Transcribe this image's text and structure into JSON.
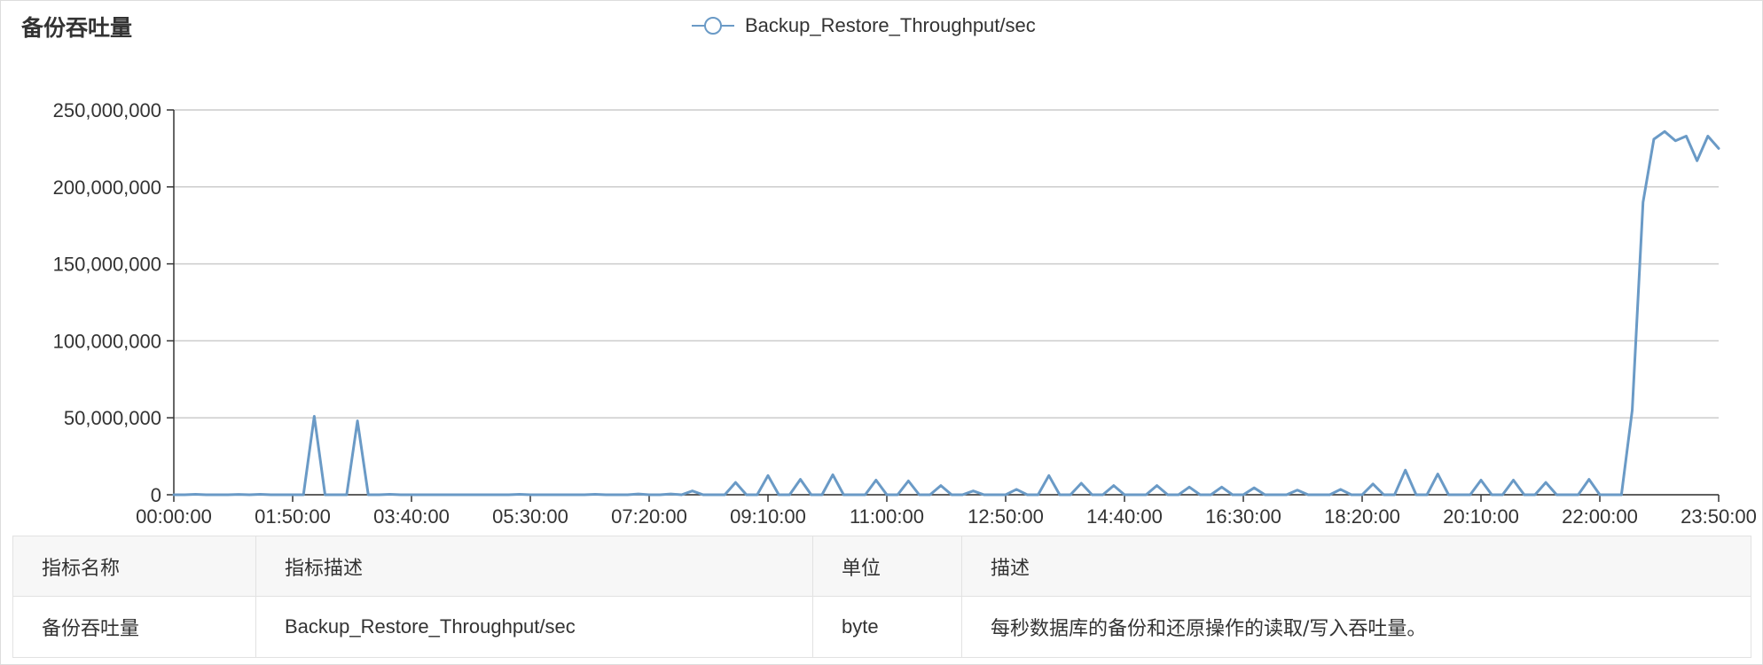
{
  "panel": {
    "title": "备份吞吐量"
  },
  "chart_data": {
    "type": "line",
    "title": "",
    "xlabel": "",
    "ylabel": "",
    "x_ticks": [
      "00:00:00",
      "01:50:00",
      "03:40:00",
      "05:30:00",
      "07:20:00",
      "09:10:00",
      "11:00:00",
      "12:50:00",
      "14:40:00",
      "16:30:00",
      "18:20:00",
      "20:10:00",
      "22:00:00",
      "23:50:00"
    ],
    "y_ticks": [
      "0",
      "50,000,000",
      "100,000,000",
      "150,000,000",
      "200,000,000",
      "250,000,000"
    ],
    "ylim": [
      0,
      250000000
    ],
    "xlim_minutes": [
      0,
      1430
    ],
    "x_minutes": [
      0,
      10,
      20,
      30,
      40,
      50,
      60,
      70,
      80,
      90,
      100,
      110,
      120,
      130,
      140,
      150,
      160,
      170,
      180,
      190,
      200,
      210,
      220,
      230,
      240,
      250,
      260,
      270,
      280,
      290,
      300,
      310,
      320,
      330,
      340,
      350,
      360,
      370,
      380,
      390,
      400,
      410,
      420,
      430,
      440,
      450,
      460,
      470,
      480,
      490,
      500,
      510,
      520,
      530,
      540,
      550,
      560,
      570,
      580,
      590,
      600,
      610,
      620,
      630,
      640,
      650,
      660,
      670,
      680,
      690,
      700,
      710,
      720,
      730,
      740,
      750,
      760,
      770,
      780,
      790,
      800,
      810,
      820,
      830,
      840,
      850,
      860,
      870,
      880,
      890,
      900,
      910,
      920,
      930,
      940,
      950,
      960,
      970,
      980,
      990,
      1000,
      1010,
      1020,
      1030,
      1040,
      1050,
      1060,
      1070,
      1080,
      1090,
      1100,
      1110,
      1120,
      1130,
      1140,
      1150,
      1160,
      1170,
      1180,
      1190,
      1200,
      1210,
      1220,
      1230,
      1240,
      1250,
      1260,
      1270,
      1280,
      1290,
      1300,
      1310,
      1320,
      1330,
      1340,
      1350,
      1360,
      1370,
      1380,
      1390,
      1400,
      1410,
      1420,
      1430
    ],
    "series": [
      {
        "name": "Backup_Restore_Throughput/sec",
        "color": "#6a9ac6",
        "values": [
          0,
          0,
          300000,
          0,
          0,
          0,
          200000,
          0,
          300000,
          0,
          0,
          0,
          0,
          51000000,
          0,
          0,
          0,
          48000000,
          0,
          0,
          300000,
          0,
          0,
          0,
          0,
          0,
          0,
          0,
          0,
          0,
          0,
          0,
          300000,
          0,
          0,
          0,
          0,
          0,
          0,
          300000,
          0,
          0,
          0,
          500000,
          0,
          0,
          500000,
          0,
          2500000,
          0,
          0,
          0,
          8000000,
          0,
          0,
          12500000,
          0,
          0,
          10000000,
          0,
          0,
          13000000,
          0,
          0,
          0,
          9500000,
          0,
          0,
          9000000,
          0,
          0,
          6000000,
          0,
          0,
          2500000,
          0,
          0,
          0,
          3500000,
          0,
          0,
          12500000,
          0,
          0,
          7500000,
          0,
          0,
          6000000,
          0,
          0,
          0,
          6000000,
          0,
          0,
          5000000,
          0,
          0,
          5000000,
          0,
          0,
          4500000,
          0,
          0,
          0,
          3000000,
          0,
          0,
          0,
          3500000,
          0,
          0,
          7000000,
          0,
          0,
          16000000,
          0,
          0,
          13500000,
          0,
          0,
          0,
          9500000,
          0,
          0,
          9500000,
          0,
          0,
          8000000,
          0,
          0,
          0,
          10000000,
          0,
          0,
          0,
          55000000,
          190000000,
          231000000,
          236000000,
          230000000,
          233000000,
          217000000,
          233000000,
          225000000
        ]
      }
    ]
  },
  "table": {
    "headers": [
      "指标名称",
      "指标描述",
      "单位",
      "描述"
    ],
    "rows": [
      [
        "备份吞吐量",
        "Backup_Restore_Throughput/sec",
        "byte",
        "每秒数据库的备份和还原操作的读取/写入吞吐量。"
      ]
    ]
  }
}
